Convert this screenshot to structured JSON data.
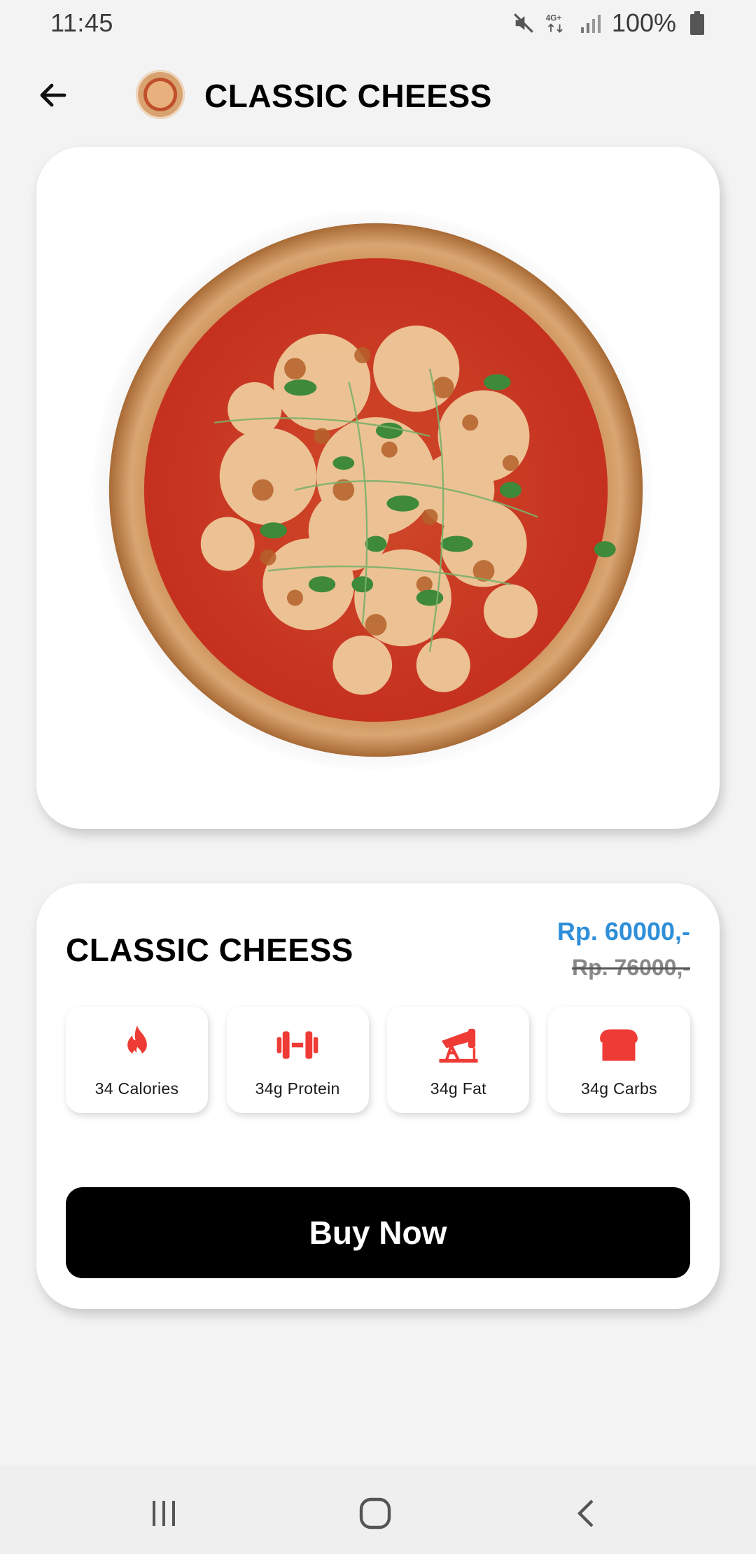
{
  "status_bar": {
    "time": "11:45",
    "network": "4G+",
    "battery": "100%"
  },
  "app_bar": {
    "title": "CLASSIC CHEESS"
  },
  "product": {
    "name": "CLASSIC CHEESS",
    "price": "Rp. 60000,-",
    "old_price": "Rp. 76000,-"
  },
  "nutrition": [
    {
      "icon": "flame-icon",
      "label": "34 Calories"
    },
    {
      "icon": "dumbbell-icon",
      "label": "34g Protein"
    },
    {
      "icon": "oil-pump-icon",
      "label": "34g Fat"
    },
    {
      "icon": "bread-icon",
      "label": "34g Carbs"
    }
  ],
  "actions": {
    "buy_label": "Buy Now"
  },
  "colors": {
    "accent_red": "#ef3b35",
    "price_blue": "#2f8fd8",
    "button_black": "#000000"
  }
}
